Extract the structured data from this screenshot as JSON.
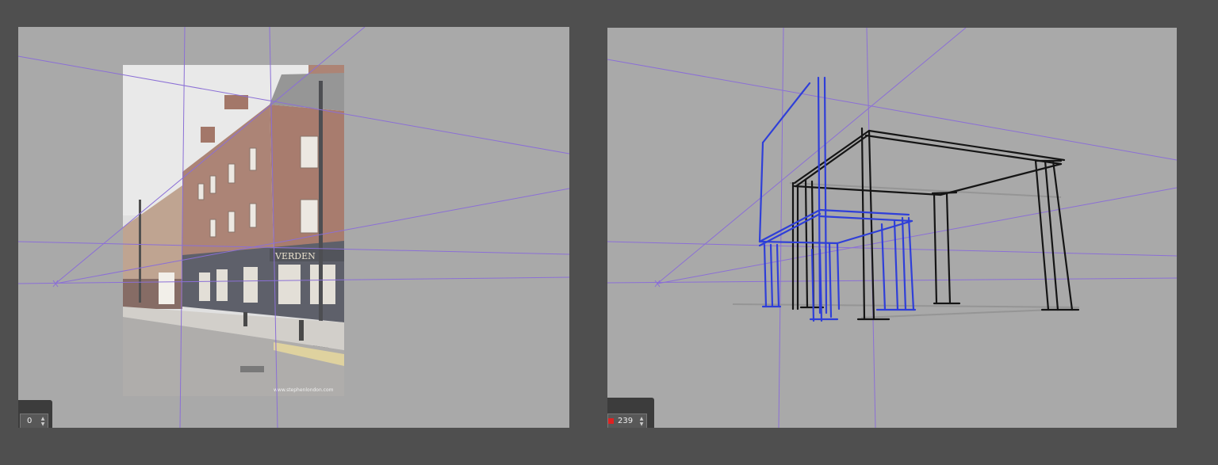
{
  "colors": {
    "app_background": "#4f4f4f",
    "canvas_background": "#a9a9a9",
    "perspective_guide": "#8b6fd6",
    "blue_sketch": "#2f3fd8",
    "black_sketch": "#151515"
  },
  "left_view": {
    "reference_photo": {
      "sign_text": "VERDEN",
      "watermark": "www.stephenlondon.com"
    },
    "frame_counter": {
      "value": "0",
      "up_icon": "▲",
      "down_icon": "▼"
    }
  },
  "right_view": {
    "frame_counter": {
      "value": "239",
      "up_icon": "▲",
      "down_icon": "▼"
    }
  }
}
